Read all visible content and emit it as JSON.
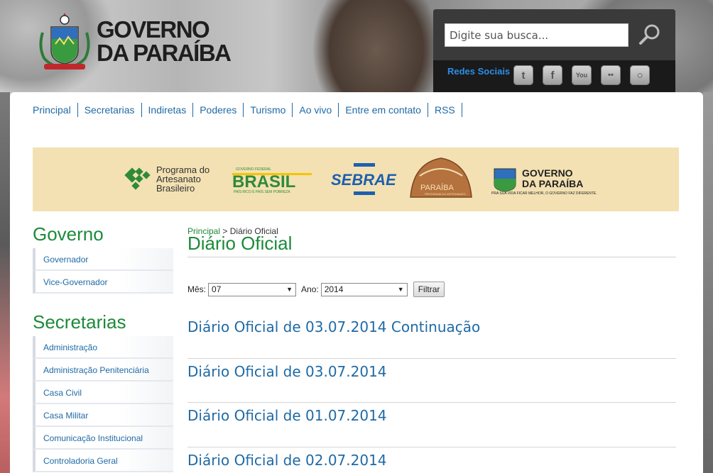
{
  "logo": {
    "line1": "GOVERNO",
    "line2": "DA PARAÍBA",
    "seal_alt": "coat-of-arms"
  },
  "search": {
    "placeholder": "Digite sua busca..."
  },
  "social": {
    "label": "Redes Sociais",
    "icons": [
      "twitter-icon",
      "facebook-icon",
      "youtube-icon",
      "flickr-icon",
      "instagram-icon"
    ],
    "glyphs": [
      "t",
      "f",
      "You",
      "••",
      "○"
    ]
  },
  "nav": [
    "Principal",
    "Secretarias",
    "Indiretas",
    "Poderes",
    "Turismo",
    "Ao vivo",
    "Entre em contato",
    "RSS"
  ],
  "banner": {
    "programa": [
      "Programa do",
      "Artesanato",
      "Brasileiro"
    ],
    "brasil_top": "GOVERNO FEDERAL",
    "brasil": "BRASIL",
    "brasil_sub": "PAÍS RICO É PAÍS SEM POBREZA",
    "sebrae": "SEBRAE",
    "paraiba": "PARAÍBA",
    "paraiba_sub": "PROGRAMA DO ARTESANATO",
    "gov1": "GOVERNO",
    "gov2": "DA PARAÍBA",
    "gov_sub": "PRA SUA VIDA FICAR MELHOR, O GOVERNO FAZ DIFERENTE."
  },
  "sidebar": {
    "governo_heading": "Governo",
    "governo_items": [
      "Governador",
      "Vice-Governador"
    ],
    "secretarias_heading": "Secretarias",
    "secretarias_items": [
      "Administração",
      "Administração Penitenciária",
      "Casa Civil",
      "Casa Militar",
      "Comunicação Institucional",
      "Controladoria Geral"
    ]
  },
  "breadcrumb": {
    "home": "Principal",
    "sep": ">",
    "current": "Diário Oficial"
  },
  "page_title": "Diário Oficial",
  "filter": {
    "month_label": "Mês:",
    "month_value": "07",
    "year_label": "Ano:",
    "year_value": "2014",
    "button": "Filtrar"
  },
  "results": [
    "Diário Oficial de 03.07.2014 Continuação",
    "Diário Oficial de 03.07.2014",
    "Diário Oficial de 01.07.2014",
    "Diário Oficial de 02.07.2014"
  ],
  "colors": {
    "green": "#1d8a3a",
    "blue": "#1f6aa5",
    "banner_bg": "#f3e1b3"
  }
}
